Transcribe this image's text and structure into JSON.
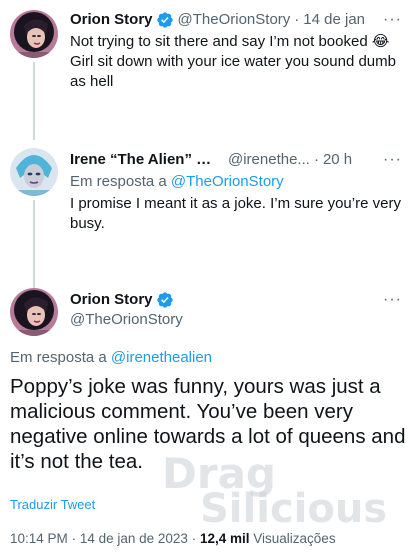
{
  "tweet1": {
    "name": "Orion Story",
    "handle": "@TheOrionStory",
    "separator": "·",
    "time": "14 de jan",
    "line1": "Not trying to sit there and say I’m not booked",
    "line1_emoji": "😂",
    "line2": "Girl sit down with your ice water you sound dumb as hell"
  },
  "tweet2": {
    "name": "Irene “The Alien” Du...",
    "handle": "@irenethe...",
    "separator": "·",
    "time": "20 h",
    "reply_prefix": "Em resposta a",
    "reply_to": "@TheOrionStory",
    "text": "I promise I meant it as a joke. I’m sure you’re very busy."
  },
  "main": {
    "name": "Orion Story",
    "handle": "@TheOrionStory",
    "reply_prefix": "Em resposta a",
    "reply_to": "@irenethealien",
    "text": "Poppy’s joke was funny, yours was just a malicious comment. You’ve been very negative online towards a lot of queens and it’s not the tea.",
    "translate": "Traduzir Tweet",
    "meta": {
      "time": "10:14 PM",
      "separator": "·",
      "date": "14 de jan de 2023",
      "views_count": "12,4 mil",
      "views_label": "Visualizações"
    }
  },
  "more_label": "···",
  "watermark": {
    "line1": "Drag",
    "line2": "Silicious"
  },
  "colors": {
    "accent": "#1d9bf0",
    "muted": "#536471",
    "text": "#0f1419",
    "thread_line": "#cfd9de"
  },
  "icons": [
    "verified-badge-icon",
    "more-options-icon"
  ]
}
